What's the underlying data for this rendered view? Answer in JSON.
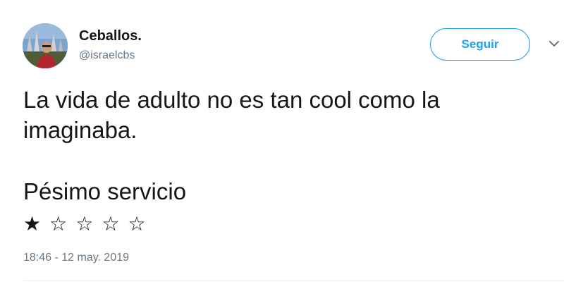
{
  "user": {
    "name": "Ceballos.",
    "handle": "@israelcbs",
    "avatar_icon": "profile-photo"
  },
  "follow_button": {
    "label": "Seguir",
    "color": "#1da1f2"
  },
  "menu": {
    "icon": "chevron-down-icon"
  },
  "tweet": {
    "text_line1": "La vida de adulto no es tan cool como la",
    "text_line2": "imaginaba.",
    "rating_title": "Pésimo servicio",
    "rating": {
      "filled": 1,
      "max": 5,
      "stars": [
        "★",
        "☆",
        "☆",
        "☆",
        "☆"
      ]
    },
    "timestamp": "18:46 - 12 may. 2019"
  }
}
